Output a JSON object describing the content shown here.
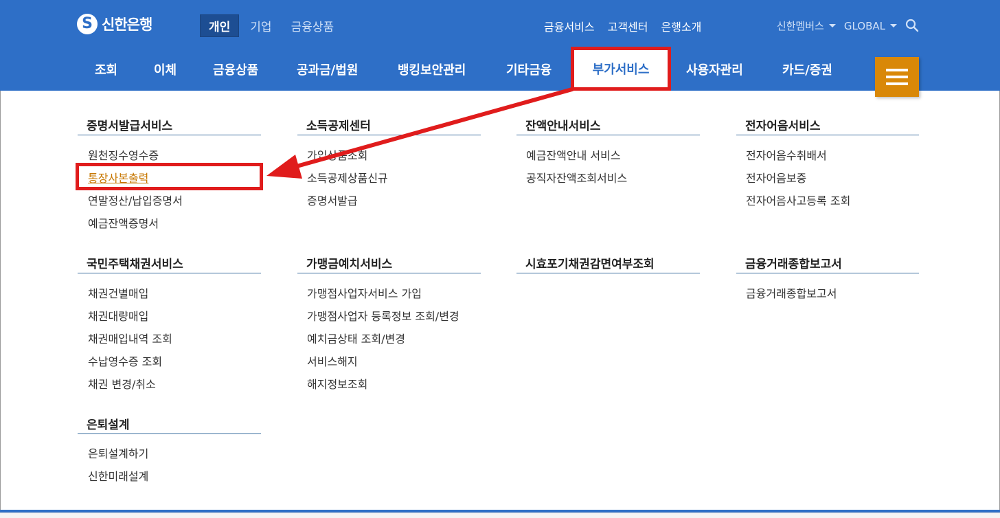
{
  "logo": {
    "text": "신한은행"
  },
  "top_tabs": [
    {
      "label": "개인",
      "active": true
    },
    {
      "label": "기업",
      "active": false
    },
    {
      "label": "금융상품",
      "active": false
    }
  ],
  "util_links": [
    "금융서비스",
    "고객센터",
    "은행소개"
  ],
  "right_links": {
    "members": "신한멤버스",
    "global": "GLOBAL"
  },
  "gnb": [
    "조회",
    "이체",
    "금융상품",
    "공과금/법원",
    "뱅킹보안관리",
    "기타금융",
    "부가서비스",
    "사용자관리",
    "카드/증권"
  ],
  "gnb_selected": "부가서비스",
  "sections": [
    {
      "title": "증명서발급서비스",
      "items": [
        "원천징수영수증",
        "통장사본출력",
        "연말정산/납입증명서",
        "예금잔액증명서"
      ]
    },
    {
      "title": "소득공제센터",
      "items": [
        "가입상품조회",
        "소득공제상품신규",
        "증명서발급"
      ]
    },
    {
      "title": "잔액안내서비스",
      "items": [
        "예금잔액안내 서비스",
        "공직자잔액조회서비스"
      ]
    },
    {
      "title": "전자어음서비스",
      "items": [
        "전자어음수취배서",
        "전자어음보증",
        "전자어음사고등록 조회"
      ]
    },
    {
      "title": "국민주택채권서비스",
      "items": [
        "채권건별매입",
        "채권대량매입",
        "채권매입내역 조회",
        "수납영수증 조회",
        "채권 변경/취소"
      ]
    },
    {
      "title": "가맹금예치서비스",
      "items": [
        "가맹점사업자서비스 가입",
        "가맹점사업자 등록정보 조회/변경",
        "예치금상태 조회/변경",
        "서비스해지",
        "해지정보조회"
      ]
    },
    {
      "title": "시효포기채권감면여부조회",
      "items": []
    },
    {
      "title": "금융거래종합보고서",
      "items": [
        "금융거래종합보고서"
      ]
    },
    {
      "title": "은퇴설계",
      "items": [
        "은퇴설계하기",
        "신한미래설계"
      ]
    }
  ],
  "highlighted_item": "통장사본출력",
  "colors": {
    "brand_blue": "#2e6fc7",
    "menu_orange": "#d98808",
    "annotation_red": "#e01c1c",
    "link_highlight": "#c77700"
  }
}
